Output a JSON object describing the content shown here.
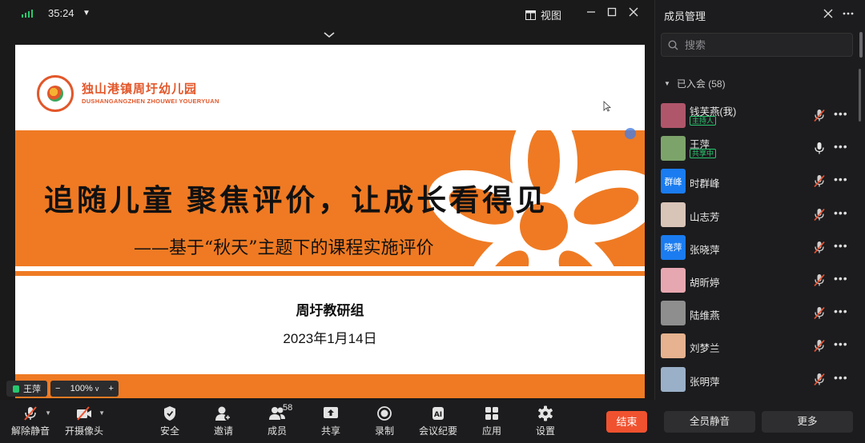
{
  "titlebar": {
    "timer": "35:24",
    "view_label": "视图"
  },
  "slide": {
    "logo_cn": "独山港镇周圩幼儿园",
    "logo_en": "DUSHANGANGZHEN ZHOUWEI YOUERYUAN",
    "title": "追随儿童 聚焦评价，让成长看得见",
    "subtitle": "——基于“秋天”主题下的课程实施评价",
    "organization": "周圩教研组",
    "date": "2023年1月14日",
    "accent_color": "#ef7a23"
  },
  "speaker": {
    "name": "王萍"
  },
  "zoom": {
    "level": "100%",
    "minus": "−",
    "plus": "+"
  },
  "toolbar": {
    "unmute": "解除静音",
    "camera": "开摄像头",
    "security": "安全",
    "invite": "邀请",
    "members": "成员",
    "members_count": "58",
    "share": "共享",
    "record": "录制",
    "minutes": "会议纪要",
    "apps": "应用",
    "settings": "设置",
    "end": "结束",
    "end_color": "#f0522f"
  },
  "panel": {
    "title": "成员管理",
    "search_placeholder": "搜索",
    "group_label": "已入会 (58)",
    "mute_all": "全员静音",
    "more": "更多",
    "members": [
      {
        "name": "钱芙燕(我)",
        "role": "主持人",
        "avatar_color": "#b0566a",
        "avatar_text": "",
        "mic": "muted"
      },
      {
        "name": "王萍",
        "role": "共享中",
        "avatar_color": "#7ca46a",
        "avatar_text": "",
        "mic": "on"
      },
      {
        "name": "时群峰",
        "role": "",
        "avatar_color": "#1a7cf0",
        "avatar_text": "群峰",
        "mic": "muted"
      },
      {
        "name": "山志芳",
        "role": "",
        "avatar_color": "#d9c4b8",
        "avatar_text": "",
        "mic": "muted"
      },
      {
        "name": "张晓萍",
        "role": "",
        "avatar_color": "#1a7cf0",
        "avatar_text": "晓萍",
        "mic": "muted"
      },
      {
        "name": "胡昕婷",
        "role": "",
        "avatar_color": "#e7a7b0",
        "avatar_text": "",
        "mic": "muted"
      },
      {
        "name": "陆维燕",
        "role": "",
        "avatar_color": "#8e8e8e",
        "avatar_text": "",
        "mic": "muted"
      },
      {
        "name": "刘梦兰",
        "role": "",
        "avatar_color": "#e6b28f",
        "avatar_text": "",
        "mic": "muted"
      },
      {
        "name": "张明萍",
        "role": "",
        "avatar_color": "#9ab0c8",
        "avatar_text": "",
        "mic": "muted"
      }
    ]
  }
}
